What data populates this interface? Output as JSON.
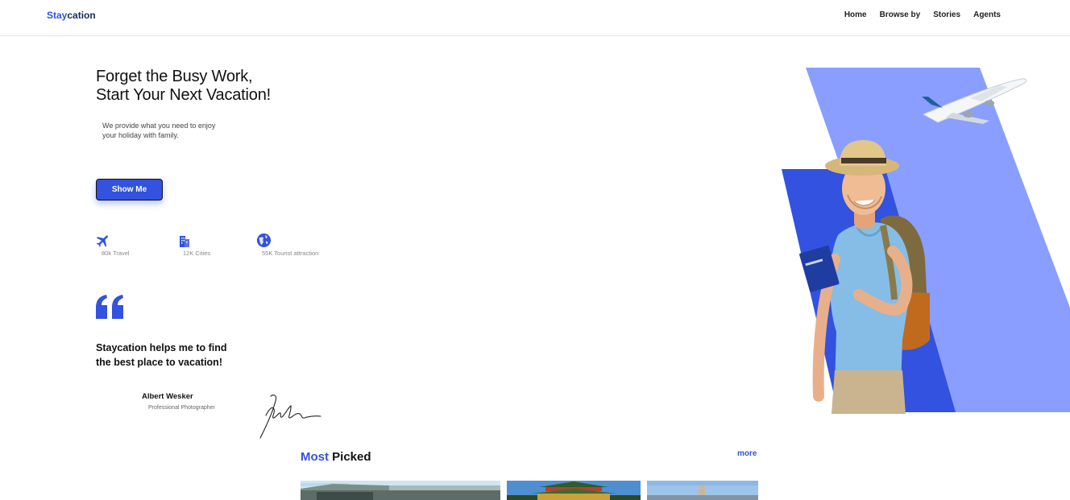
{
  "header": {
    "logo_accent": "Stay",
    "logo_rest": "cation",
    "nav": [
      "Home",
      "Browse by",
      "Stories",
      "Agents"
    ]
  },
  "hero": {
    "headline_line1": "Forget the Busy Work,",
    "headline_line2": "Start Your Next Vacation!",
    "subtext_line1": "We provide what you need to enjoy",
    "subtext_line2": "your holiday with family.",
    "cta_label": "Show Me",
    "stats": [
      {
        "icon": "airplane-icon",
        "label": "80k Travel"
      },
      {
        "icon": "city-icon",
        "label": "12K Cities"
      },
      {
        "icon": "globe-icon",
        "label": "55K Tourist attraction"
      }
    ]
  },
  "testimonial": {
    "quote_line1": "Staycation helps me to find",
    "quote_line2": "the best place to vacation!",
    "author": "Albert Wesker",
    "role": "Professional Photographer"
  },
  "most_picked": {
    "title_accent": "Most",
    "title_rest": "Picked",
    "more_label": "more"
  },
  "colors": {
    "accent": "#3252DF",
    "accent_light": "#8A9EFF",
    "text_dark": "#111111"
  }
}
